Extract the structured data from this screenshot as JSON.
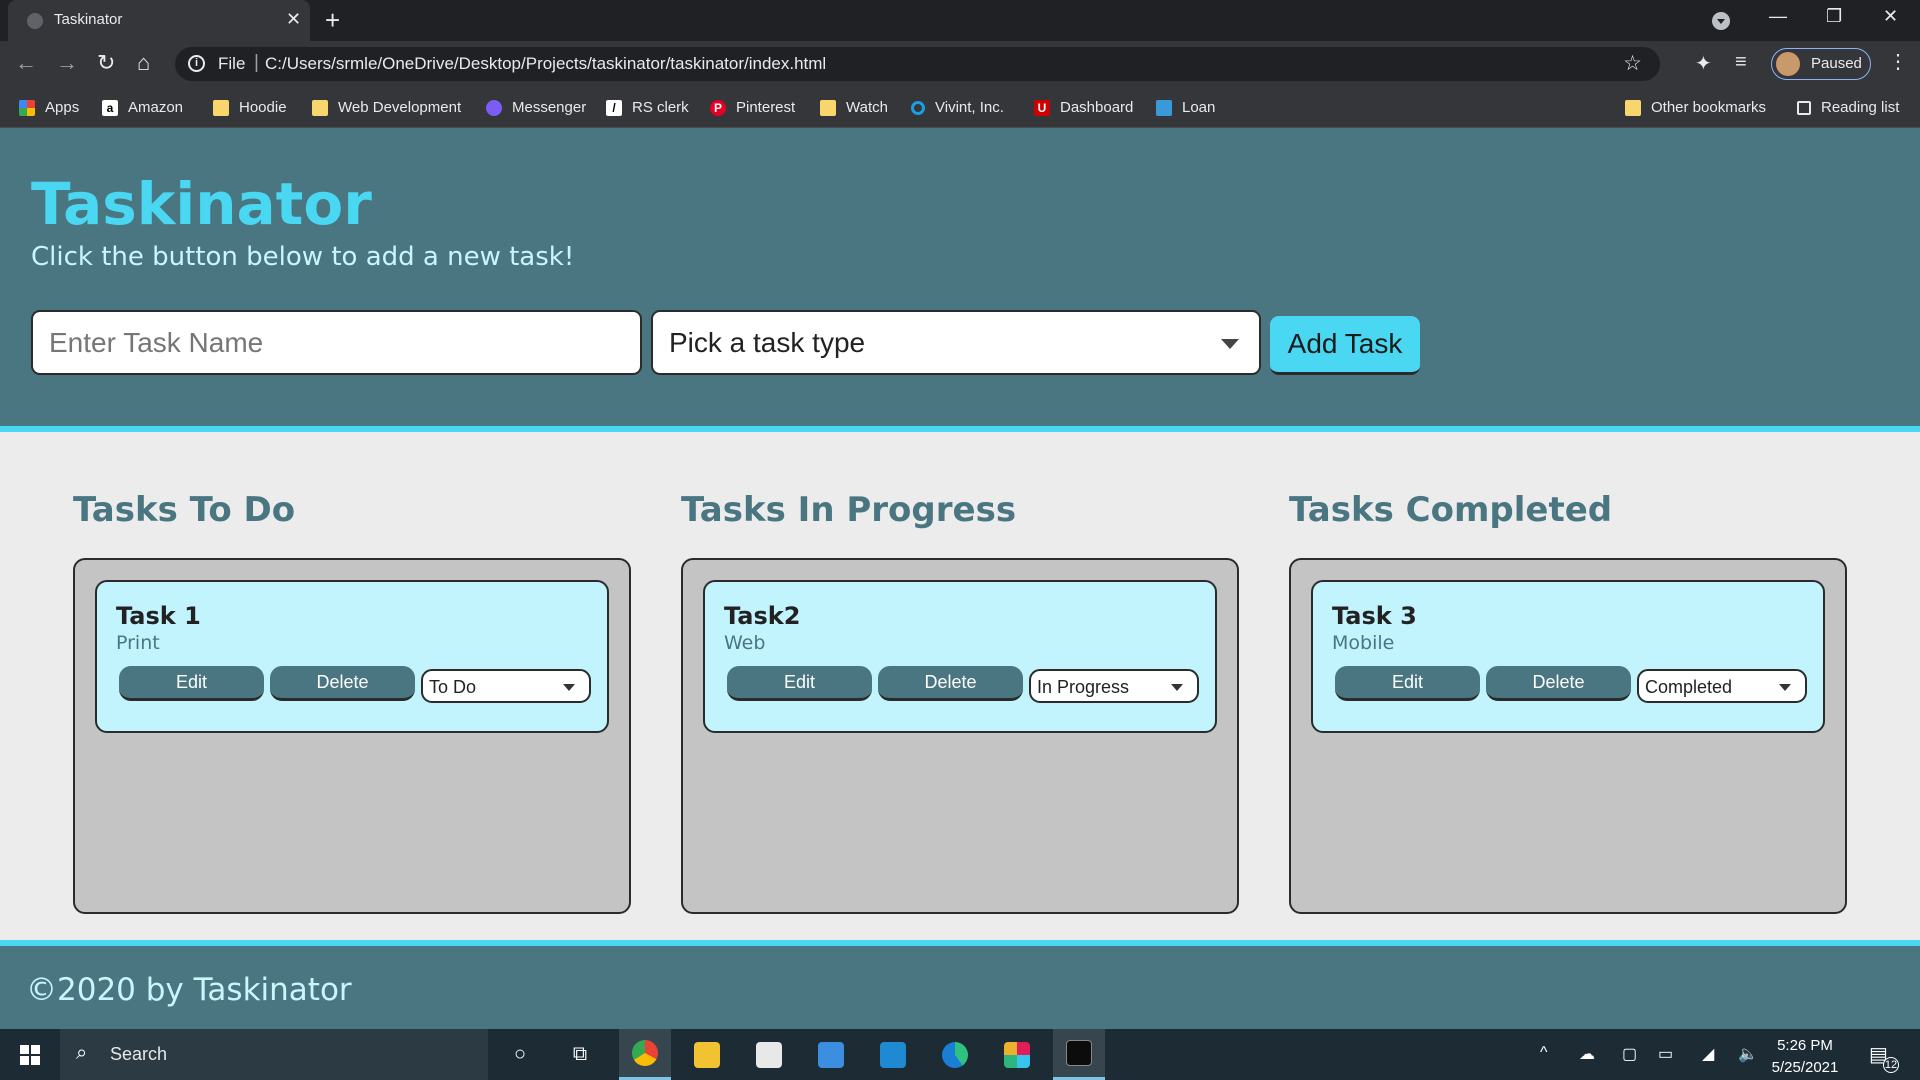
{
  "browser": {
    "tab_title": "Taskinator",
    "tab_close": "✕",
    "new_tab": "+",
    "window": {
      "minimize": "—",
      "restore": "❐",
      "close": "✕"
    },
    "nav": {
      "back": "←",
      "forward": "→",
      "reload": "↻",
      "home": "⌂"
    },
    "omnibox": {
      "info": "i",
      "scheme": "File",
      "separator": "|",
      "url": "C:/Users/srmle/OneDrive/Desktop/Projects/taskinator/taskinator/index.html",
      "star": "☆"
    },
    "toolbar_icons": {
      "extensions": "✦",
      "media": "≡"
    },
    "profile_label": "Paused",
    "menu": "⋮",
    "bookmarks": [
      {
        "label": "Apps",
        "icon": "apps-icon"
      },
      {
        "label": "Amazon",
        "icon": "amazon-icon"
      },
      {
        "label": "Hoodie",
        "icon": "folder-icon"
      },
      {
        "label": "Web Development",
        "icon": "folder-icon"
      },
      {
        "label": "Messenger",
        "icon": "messenger-icon"
      },
      {
        "label": "RS clerk",
        "icon": "rs-clerk-icon"
      },
      {
        "label": "Pinterest",
        "icon": "pinterest-icon"
      },
      {
        "label": "Watch",
        "icon": "folder-icon"
      },
      {
        "label": "Vivint, Inc.",
        "icon": "vivint-icon"
      },
      {
        "label": "Dashboard",
        "icon": "dashboard-icon"
      },
      {
        "label": "Loan",
        "icon": "loan-icon"
      }
    ],
    "other_bookmarks": "Other bookmarks",
    "reading_list": "Reading list"
  },
  "header": {
    "title": "Taskinator",
    "subtitle": "Click the button below to add a new task!"
  },
  "form": {
    "task_name_placeholder": "Enter Task Name",
    "task_type_value": "Pick a task type",
    "add_button": "Add Task"
  },
  "columns": [
    {
      "title": "Tasks To Do",
      "tasks": [
        {
          "name": "Task 1",
          "type": "Print",
          "edit": "Edit",
          "delete": "Delete",
          "status": "To Do"
        }
      ]
    },
    {
      "title": "Tasks In Progress",
      "tasks": [
        {
          "name": "Task2",
          "type": "Web",
          "edit": "Edit",
          "delete": "Delete",
          "status": "In Progress"
        }
      ]
    },
    {
      "title": "Tasks Completed",
      "tasks": [
        {
          "name": "Task 3",
          "type": "Mobile",
          "edit": "Edit",
          "delete": "Delete",
          "status": "Completed"
        }
      ]
    }
  ],
  "footer": {
    "text": "©2020 by Taskinator"
  },
  "taskbar": {
    "search_label": "Search",
    "search_icon": "⌕",
    "cortana": "○",
    "task_view": "⧉",
    "apps": [
      "chrome-icon",
      "file-explorer-icon",
      "store-icon",
      "mail-icon",
      "vscode-icon",
      "edge-icon",
      "slack-icon",
      "terminal-icon"
    ],
    "tray": {
      "chevron": "^",
      "cloud": "☁",
      "network": "◢",
      "volume": "🔈"
    },
    "time": "5:26 PM",
    "date": "5/25/2021",
    "notifications": "12"
  }
}
